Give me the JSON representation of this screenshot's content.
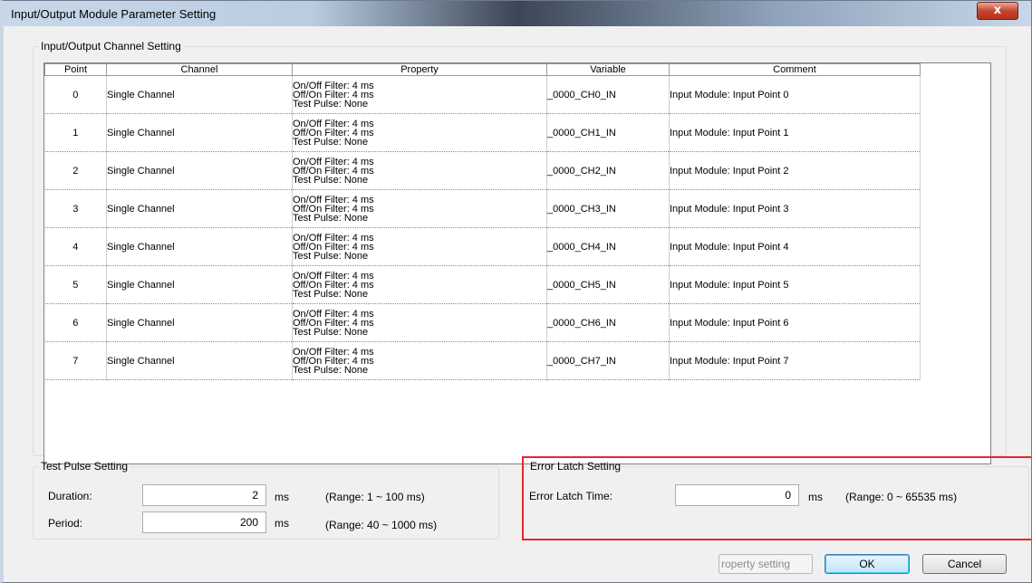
{
  "window": {
    "title": "Input/Output Module Parameter Setting",
    "close_glyph": "x"
  },
  "channel_setting": {
    "legend": "Input/Output Channel Setting",
    "columns": [
      "Point",
      "Channel",
      "Property",
      "Variable",
      "Comment"
    ],
    "rows": [
      {
        "point": "0",
        "channel": "Single Channel",
        "property": [
          "On/Off Filter: 4 ms",
          "Off/On Filter: 4 ms",
          "Test Pulse: None"
        ],
        "variable": "_0000_CH0_IN",
        "comment": "Input Module: Input Point 0"
      },
      {
        "point": "1",
        "channel": "Single Channel",
        "property": [
          "On/Off Filter: 4 ms",
          "Off/On Filter: 4 ms",
          "Test Pulse: None"
        ],
        "variable": "_0000_CH1_IN",
        "comment": "Input Module: Input Point 1"
      },
      {
        "point": "2",
        "channel": "Single Channel",
        "property": [
          "On/Off Filter: 4 ms",
          "Off/On Filter: 4 ms",
          "Test Pulse: None"
        ],
        "variable": "_0000_CH2_IN",
        "comment": "Input Module: Input Point 2"
      },
      {
        "point": "3",
        "channel": "Single Channel",
        "property": [
          "On/Off Filter: 4 ms",
          "Off/On Filter: 4 ms",
          "Test Pulse: None"
        ],
        "variable": "_0000_CH3_IN",
        "comment": "Input Module: Input Point 3"
      },
      {
        "point": "4",
        "channel": "Single Channel",
        "property": [
          "On/Off Filter: 4 ms",
          "Off/On Filter: 4 ms",
          "Test Pulse: None"
        ],
        "variable": "_0000_CH4_IN",
        "comment": "Input Module: Input Point 4"
      },
      {
        "point": "5",
        "channel": "Single Channel",
        "property": [
          "On/Off Filter: 4 ms",
          "Off/On Filter: 4 ms",
          "Test Pulse: None"
        ],
        "variable": "_0000_CH5_IN",
        "comment": "Input Module: Input Point 5"
      },
      {
        "point": "6",
        "channel": "Single Channel",
        "property": [
          "On/Off Filter: 4 ms",
          "Off/On Filter: 4 ms",
          "Test Pulse: None"
        ],
        "variable": "_0000_CH6_IN",
        "comment": "Input Module: Input Point 6"
      },
      {
        "point": "7",
        "channel": "Single Channel",
        "property": [
          "On/Off Filter: 4 ms",
          "Off/On Filter: 4 ms",
          "Test Pulse: None"
        ],
        "variable": "_0000_CH7_IN",
        "comment": "Input Module: Input Point 7"
      }
    ]
  },
  "test_pulse": {
    "legend": "Test Pulse Setting",
    "duration_label": "Duration:",
    "duration_value": "2",
    "duration_unit": "ms",
    "duration_range": "(Range: 1 ~ 100 ms)",
    "period_label": "Period:",
    "period_value": "200",
    "period_unit": "ms",
    "period_range": "(Range: 40 ~ 1000 ms)"
  },
  "error_latch": {
    "legend": "Error Latch Setting",
    "time_label": "Error Latch Time:",
    "time_value": "0",
    "time_unit": "ms",
    "time_range": "(Range: 0 ~ 65535 ms)",
    "highlight_color": "#e8242b"
  },
  "buttons": {
    "property_setting": "roperty setting",
    "ok": "OK",
    "cancel": "Cancel"
  }
}
